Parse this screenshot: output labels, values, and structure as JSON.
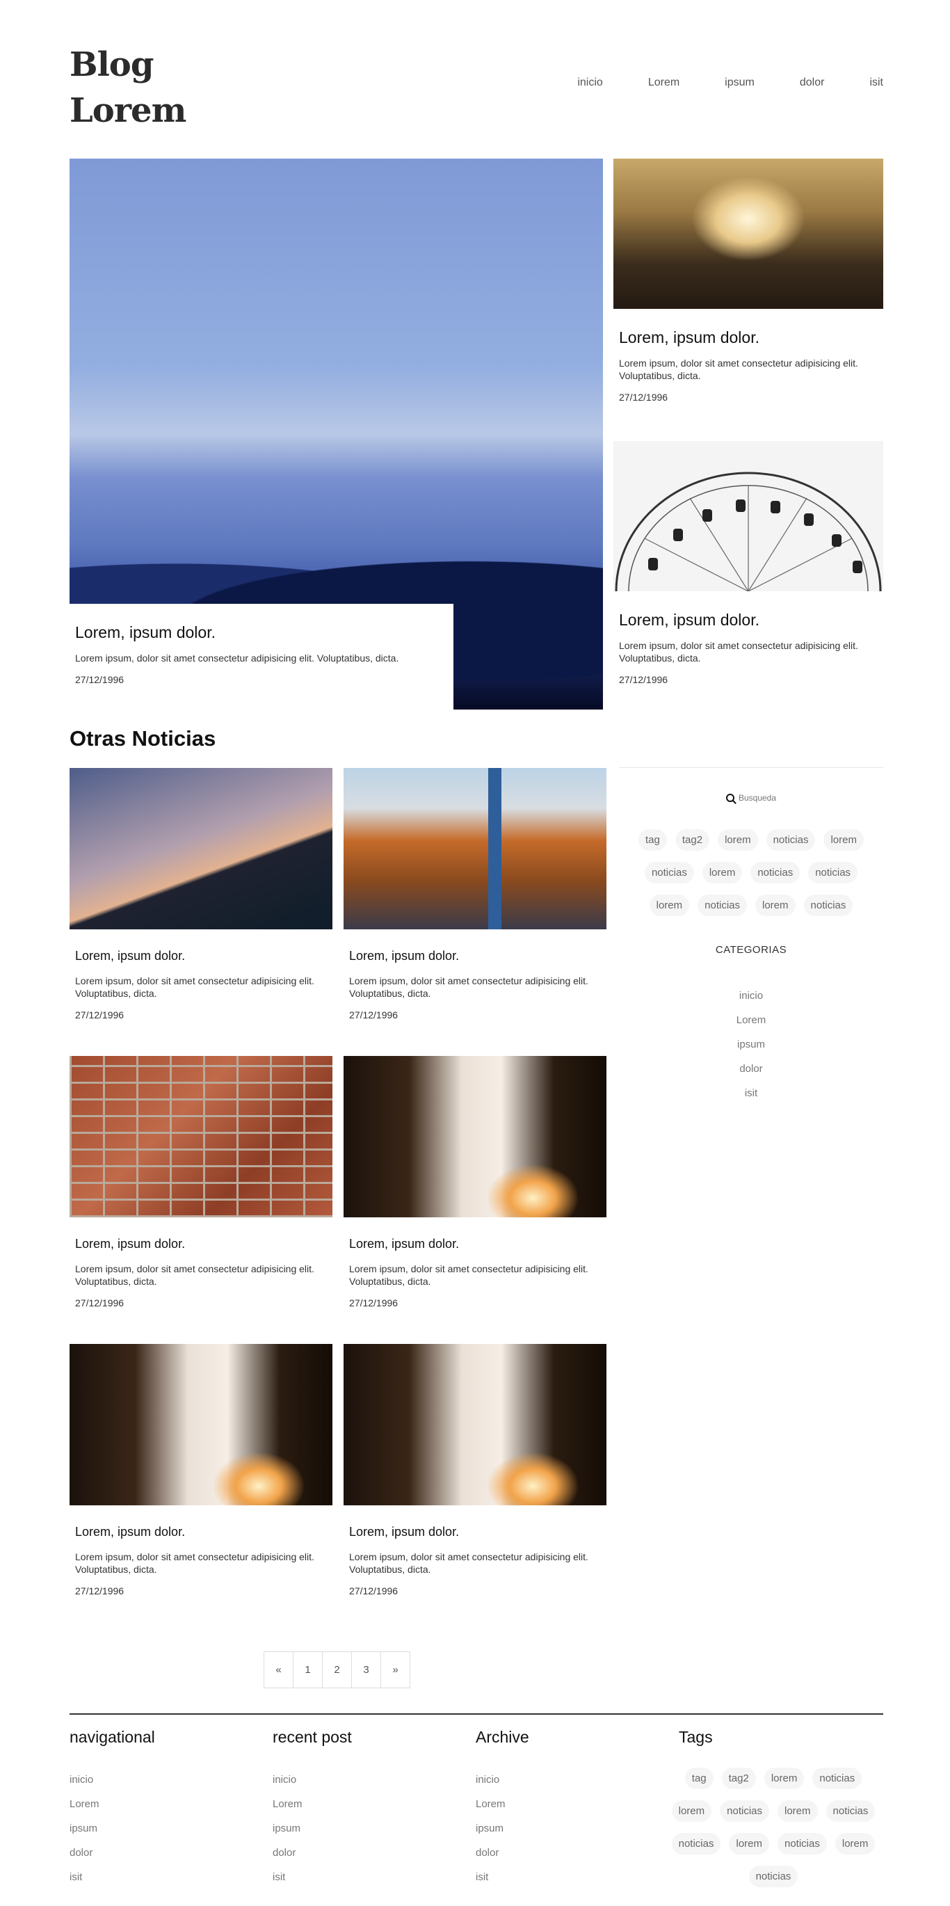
{
  "brand": {
    "line1": "Blog",
    "line2": "Lorem"
  },
  "nav": [
    "inicio",
    "Lorem",
    "ipsum",
    "dolor",
    "isit"
  ],
  "featured": {
    "main": {
      "title": "Lorem, ipsum dolor.",
      "text": "Lorem ipsum, dolor sit amet consectetur adipisicing elit. Voluptatibus, dicta.",
      "date": "27/12/1996"
    },
    "side": [
      {
        "title": "Lorem, ipsum dolor.",
        "text": "Lorem ipsum, dolor sit amet consectetur adipisicing elit. Voluptatibus, dicta.",
        "date": "27/12/1996"
      },
      {
        "title": "Lorem, ipsum dolor.",
        "text": "Lorem ipsum, dolor sit amet consectetur adipisicing elit. Voluptatibus, dicta.",
        "date": "27/12/1996"
      }
    ]
  },
  "otras": {
    "title": "Otras Noticias",
    "cards": [
      {
        "title": "Lorem, ipsum dolor.",
        "text": "Lorem ipsum, dolor sit amet consectetur adipisicing elit. Voluptatibus, dicta.",
        "date": "27/12/1996"
      },
      {
        "title": "Lorem, ipsum dolor.",
        "text": "Lorem ipsum, dolor sit amet consectetur adipisicing elit. Voluptatibus, dicta.",
        "date": "27/12/1996"
      },
      {
        "title": "Lorem, ipsum dolor.",
        "text": "Lorem ipsum, dolor sit amet consectetur adipisicing elit. Voluptatibus, dicta.",
        "date": "27/12/1996"
      },
      {
        "title": "Lorem, ipsum dolor.",
        "text": "Lorem ipsum, dolor sit amet consectetur adipisicing elit. Voluptatibus, dicta.",
        "date": "27/12/1996"
      },
      {
        "title": "Lorem, ipsum dolor.",
        "text": "Lorem ipsum, dolor sit amet consectetur adipisicing elit. Voluptatibus, dicta.",
        "date": "27/12/1996"
      },
      {
        "title": "Lorem, ipsum dolor.",
        "text": "Lorem ipsum, dolor sit amet consectetur adipisicing elit. Voluptatibus, dicta.",
        "date": "27/12/1996"
      }
    ]
  },
  "sidebar": {
    "search_placeholder": "Busqueda",
    "tags": [
      "tag",
      "tag2",
      "lorem",
      "noticias",
      "lorem",
      "noticias",
      "lorem",
      "noticias",
      "noticias",
      "lorem",
      "noticias",
      "lorem",
      "noticias"
    ],
    "categories_title": "CATEGORIAS",
    "categories": [
      "inicio",
      "Lorem",
      "ipsum",
      "dolor",
      "isit"
    ]
  },
  "pagination": [
    "«",
    "1",
    "2",
    "3",
    "»"
  ],
  "footer": {
    "cols": [
      {
        "title": "navigational",
        "items": [
          "inicio",
          "Lorem",
          "ipsum",
          "dolor",
          "isit"
        ]
      },
      {
        "title": "recent post",
        "items": [
          "inicio",
          "Lorem",
          "ipsum",
          "dolor",
          "isit"
        ]
      },
      {
        "title": "Archive",
        "items": [
          "inicio",
          "Lorem",
          "ipsum",
          "dolor",
          "isit"
        ]
      }
    ],
    "tags_title": "Tags",
    "tags": [
      "tag",
      "tag2",
      "lorem",
      "noticias",
      "lorem",
      "noticias",
      "lorem",
      "noticias",
      "noticias",
      "lorem",
      "noticias",
      "lorem",
      "noticias"
    ]
  }
}
